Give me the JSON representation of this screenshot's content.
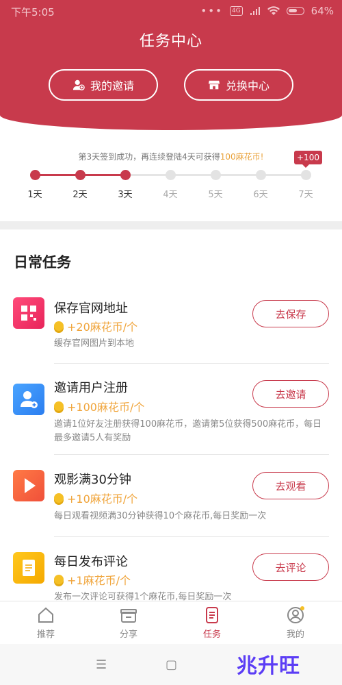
{
  "status_bar": {
    "time": "下午5:05",
    "signal_tag": "4G",
    "battery_pct": "64%"
  },
  "header": {
    "title": "任务中心",
    "invite_label": "我的邀请",
    "exchange_label": "兑换中心"
  },
  "signin": {
    "tip_prefix": "第3天签到成功，再连续登陆4天可获得",
    "tip_highlight": "100麻花币!",
    "bonus_badge": "+100",
    "days": [
      "1天",
      "2天",
      "3天",
      "4天",
      "5天",
      "6天",
      "7天"
    ],
    "completed_days": 3
  },
  "daily": {
    "section_title": "日常任务",
    "tasks": [
      {
        "name": "保存官网地址",
        "reward": "+20麻花币/个",
        "desc": "缓存官网图片到本地",
        "button": "去保存"
      },
      {
        "name": "邀请用户注册",
        "reward": "+100麻花币/个",
        "desc": "邀请1位好友注册获得100麻花币，邀请第5位获得500麻花币，每日最多邀请5人有奖励",
        "button": "去邀请"
      },
      {
        "name": "观影满30分钟",
        "reward": "+10麻花币/个",
        "desc": "每日观看视频满30分钟获得10个麻花币,每日奖励一次",
        "button": "去观看"
      },
      {
        "name": "每日发布评论",
        "reward": "+1麻花币/个",
        "desc": "发布一次评论可获得1个麻花币,每日奖励一次",
        "button": "去评论"
      }
    ]
  },
  "nav": {
    "items": [
      "推荐",
      "分享",
      "任务",
      "我的"
    ],
    "active": "任务"
  },
  "watermark": "兆升旺",
  "colors": {
    "brand": "#c83a4c",
    "reward": "#f0a43a"
  }
}
